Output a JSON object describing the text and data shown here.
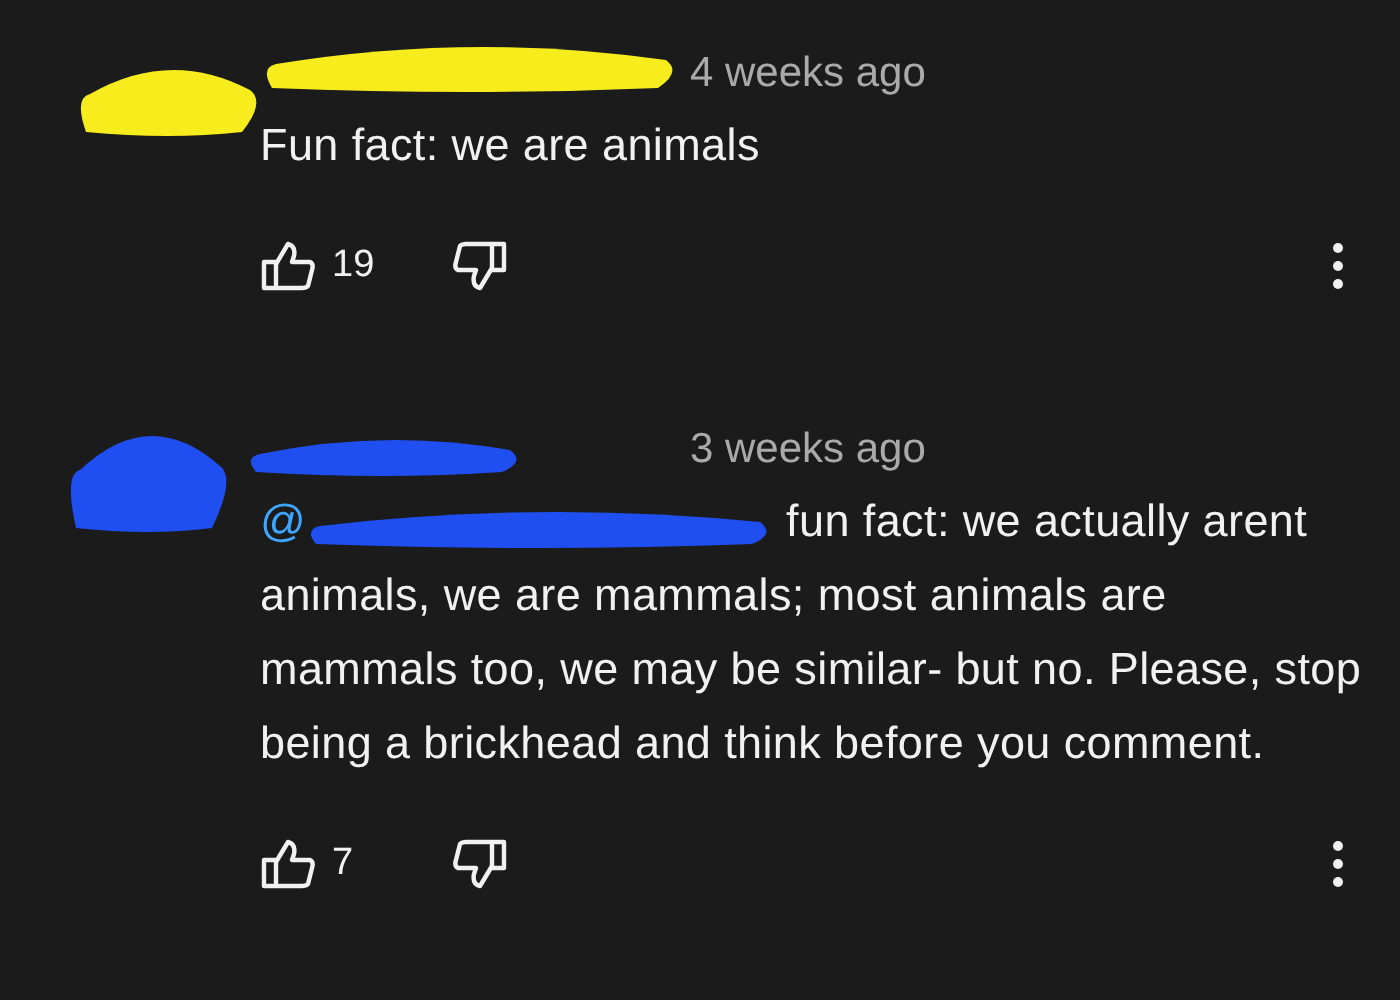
{
  "comments": [
    {
      "color": "#f7ec1c",
      "time": "4 weeks ago",
      "text": "Fun fact: we are animals",
      "likes": "19"
    },
    {
      "color": "#1f4ff0",
      "time": "3 weeks ago",
      "mention": "@",
      "text": "fun fact: we actually arent animals, we are mammals; most animals are mammals too, we may be similar- but no. Please, stop being a brickhead and think before you comment.",
      "likes": "7"
    }
  ]
}
